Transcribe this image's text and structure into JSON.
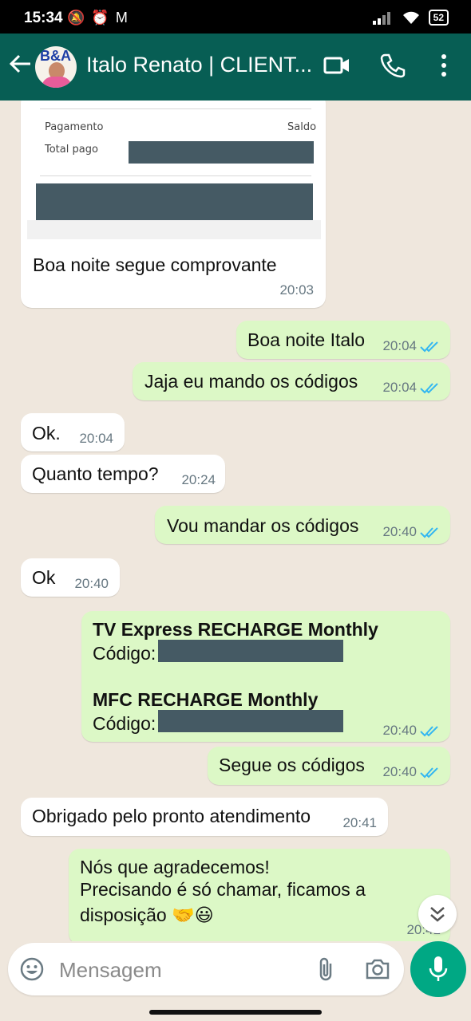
{
  "status_bar": {
    "time": "15:34",
    "battery": "52"
  },
  "header": {
    "contact_name": "Italo Renato | CLIENT...",
    "avatar_text": "B&A"
  },
  "receipt": {
    "payment_label": "Pagamento",
    "balance_label": "Saldo",
    "total_label": "Total pago"
  },
  "messages": [
    {
      "direction": "in",
      "text": "Boa noite segue comprovante",
      "time": "20:03"
    },
    {
      "direction": "out",
      "text": "Boa noite Italo",
      "time": "20:04"
    },
    {
      "direction": "out",
      "text": "Jaja eu mando os códigos",
      "time": "20:04"
    },
    {
      "direction": "in",
      "text": "Ok.",
      "time": "20:04"
    },
    {
      "direction": "in",
      "text": "Quanto tempo?",
      "time": "20:24"
    },
    {
      "direction": "out",
      "text": "Vou mandar os códigos",
      "time": "20:40"
    },
    {
      "direction": "in",
      "text": "Ok",
      "time": "20:40"
    },
    {
      "direction": "out",
      "line1": "TV Express RECHARGE Monthly",
      "code1_label": "Código:",
      "line2": "MFC RECHARGE Monthly",
      "code2_label": "Código:",
      "time": "20:40"
    },
    {
      "direction": "out",
      "text": "Segue os códigos",
      "time": "20:40"
    },
    {
      "direction": "in",
      "text": "Obrigado pelo pronto atendimento",
      "time": "20:41"
    },
    {
      "direction": "out",
      "line1": "Nós que agradecemos!",
      "line2": "Precisando é só chamar, ficamos a",
      "line3": "disposição 🤝😃",
      "time": "20:41"
    }
  ],
  "input": {
    "placeholder": "Mensagem"
  },
  "colors": {
    "header": "#075e54",
    "outgoing_bubble": "#dcf8c6",
    "incoming_bubble": "#ffffff",
    "mic_button": "#00a884",
    "read_ticks": "#34b7f1"
  }
}
